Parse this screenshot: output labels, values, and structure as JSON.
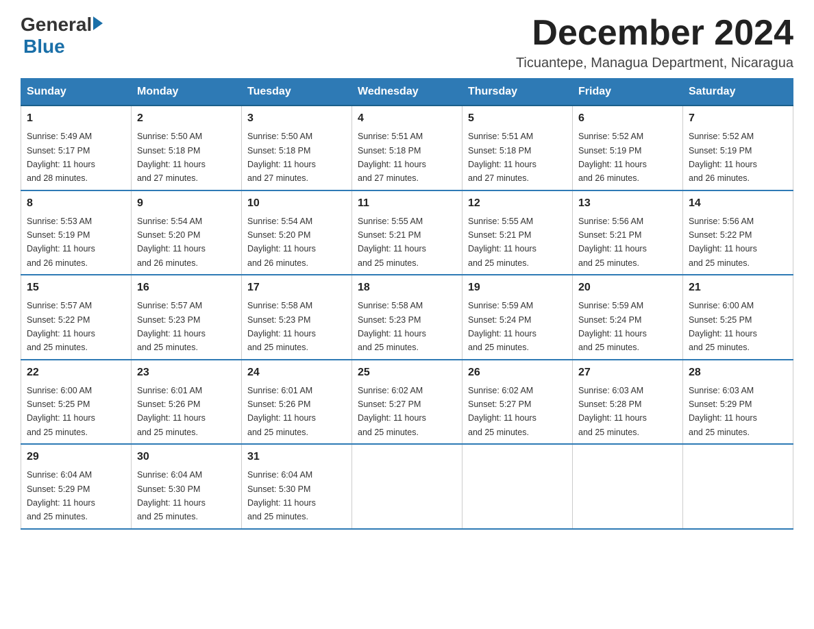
{
  "logo": {
    "general": "General",
    "blue": "Blue"
  },
  "title": "December 2024",
  "subtitle": "Ticuantepe, Managua Department, Nicaragua",
  "days_of_week": [
    "Sunday",
    "Monday",
    "Tuesday",
    "Wednesday",
    "Thursday",
    "Friday",
    "Saturday"
  ],
  "weeks": [
    [
      {
        "day": "1",
        "sunrise": "5:49 AM",
        "sunset": "5:17 PM",
        "daylight": "11 hours and 28 minutes."
      },
      {
        "day": "2",
        "sunrise": "5:50 AM",
        "sunset": "5:18 PM",
        "daylight": "11 hours and 27 minutes."
      },
      {
        "day": "3",
        "sunrise": "5:50 AM",
        "sunset": "5:18 PM",
        "daylight": "11 hours and 27 minutes."
      },
      {
        "day": "4",
        "sunrise": "5:51 AM",
        "sunset": "5:18 PM",
        "daylight": "11 hours and 27 minutes."
      },
      {
        "day": "5",
        "sunrise": "5:51 AM",
        "sunset": "5:18 PM",
        "daylight": "11 hours and 27 minutes."
      },
      {
        "day": "6",
        "sunrise": "5:52 AM",
        "sunset": "5:19 PM",
        "daylight": "11 hours and 26 minutes."
      },
      {
        "day": "7",
        "sunrise": "5:52 AM",
        "sunset": "5:19 PM",
        "daylight": "11 hours and 26 minutes."
      }
    ],
    [
      {
        "day": "8",
        "sunrise": "5:53 AM",
        "sunset": "5:19 PM",
        "daylight": "11 hours and 26 minutes."
      },
      {
        "day": "9",
        "sunrise": "5:54 AM",
        "sunset": "5:20 PM",
        "daylight": "11 hours and 26 minutes."
      },
      {
        "day": "10",
        "sunrise": "5:54 AM",
        "sunset": "5:20 PM",
        "daylight": "11 hours and 26 minutes."
      },
      {
        "day": "11",
        "sunrise": "5:55 AM",
        "sunset": "5:21 PM",
        "daylight": "11 hours and 25 minutes."
      },
      {
        "day": "12",
        "sunrise": "5:55 AM",
        "sunset": "5:21 PM",
        "daylight": "11 hours and 25 minutes."
      },
      {
        "day": "13",
        "sunrise": "5:56 AM",
        "sunset": "5:21 PM",
        "daylight": "11 hours and 25 minutes."
      },
      {
        "day": "14",
        "sunrise": "5:56 AM",
        "sunset": "5:22 PM",
        "daylight": "11 hours and 25 minutes."
      }
    ],
    [
      {
        "day": "15",
        "sunrise": "5:57 AM",
        "sunset": "5:22 PM",
        "daylight": "11 hours and 25 minutes."
      },
      {
        "day": "16",
        "sunrise": "5:57 AM",
        "sunset": "5:23 PM",
        "daylight": "11 hours and 25 minutes."
      },
      {
        "day": "17",
        "sunrise": "5:58 AM",
        "sunset": "5:23 PM",
        "daylight": "11 hours and 25 minutes."
      },
      {
        "day": "18",
        "sunrise": "5:58 AM",
        "sunset": "5:23 PM",
        "daylight": "11 hours and 25 minutes."
      },
      {
        "day": "19",
        "sunrise": "5:59 AM",
        "sunset": "5:24 PM",
        "daylight": "11 hours and 25 minutes."
      },
      {
        "day": "20",
        "sunrise": "5:59 AM",
        "sunset": "5:24 PM",
        "daylight": "11 hours and 25 minutes."
      },
      {
        "day": "21",
        "sunrise": "6:00 AM",
        "sunset": "5:25 PM",
        "daylight": "11 hours and 25 minutes."
      }
    ],
    [
      {
        "day": "22",
        "sunrise": "6:00 AM",
        "sunset": "5:25 PM",
        "daylight": "11 hours and 25 minutes."
      },
      {
        "day": "23",
        "sunrise": "6:01 AM",
        "sunset": "5:26 PM",
        "daylight": "11 hours and 25 minutes."
      },
      {
        "day": "24",
        "sunrise": "6:01 AM",
        "sunset": "5:26 PM",
        "daylight": "11 hours and 25 minutes."
      },
      {
        "day": "25",
        "sunrise": "6:02 AM",
        "sunset": "5:27 PM",
        "daylight": "11 hours and 25 minutes."
      },
      {
        "day": "26",
        "sunrise": "6:02 AM",
        "sunset": "5:27 PM",
        "daylight": "11 hours and 25 minutes."
      },
      {
        "day": "27",
        "sunrise": "6:03 AM",
        "sunset": "5:28 PM",
        "daylight": "11 hours and 25 minutes."
      },
      {
        "day": "28",
        "sunrise": "6:03 AM",
        "sunset": "5:29 PM",
        "daylight": "11 hours and 25 minutes."
      }
    ],
    [
      {
        "day": "29",
        "sunrise": "6:04 AM",
        "sunset": "5:29 PM",
        "daylight": "11 hours and 25 minutes."
      },
      {
        "day": "30",
        "sunrise": "6:04 AM",
        "sunset": "5:30 PM",
        "daylight": "11 hours and 25 minutes."
      },
      {
        "day": "31",
        "sunrise": "6:04 AM",
        "sunset": "5:30 PM",
        "daylight": "11 hours and 25 minutes."
      },
      null,
      null,
      null,
      null
    ]
  ],
  "labels": {
    "sunrise": "Sunrise:",
    "sunset": "Sunset:",
    "daylight": "Daylight:"
  }
}
